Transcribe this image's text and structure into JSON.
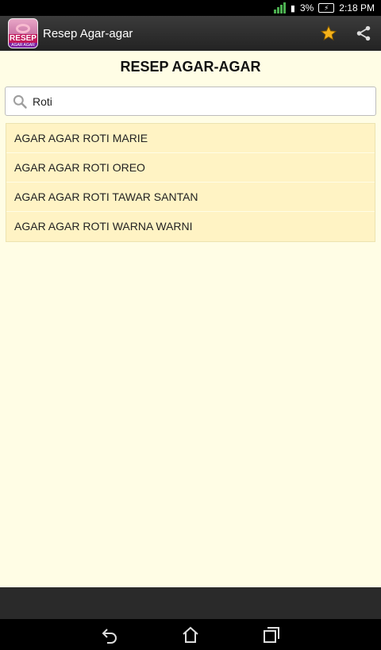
{
  "status": {
    "battery": "3%",
    "time": "2:18 PM"
  },
  "app": {
    "logo_word": "RESEP",
    "logo_sub": "AGAR AGAR",
    "title": "Resep Agar-agar"
  },
  "page": {
    "title": "RESEP AGAR-AGAR"
  },
  "search": {
    "value": "Roti"
  },
  "results": [
    {
      "label": "AGAR AGAR ROTI MARIE"
    },
    {
      "label": "AGAR AGAR ROTI OREO"
    },
    {
      "label": "AGAR AGAR ROTI TAWAR SANTAN"
    },
    {
      "label": "AGAR AGAR ROTI WARNA WARNI"
    }
  ],
  "colors": {
    "background": "#fffde5",
    "list_item": "#fff3c4",
    "star": "#f5b21a"
  },
  "icons": {
    "favorite": "star-icon",
    "share": "share-icon",
    "search": "search-icon",
    "back": "back-icon",
    "home": "home-icon",
    "recents": "recents-icon"
  }
}
